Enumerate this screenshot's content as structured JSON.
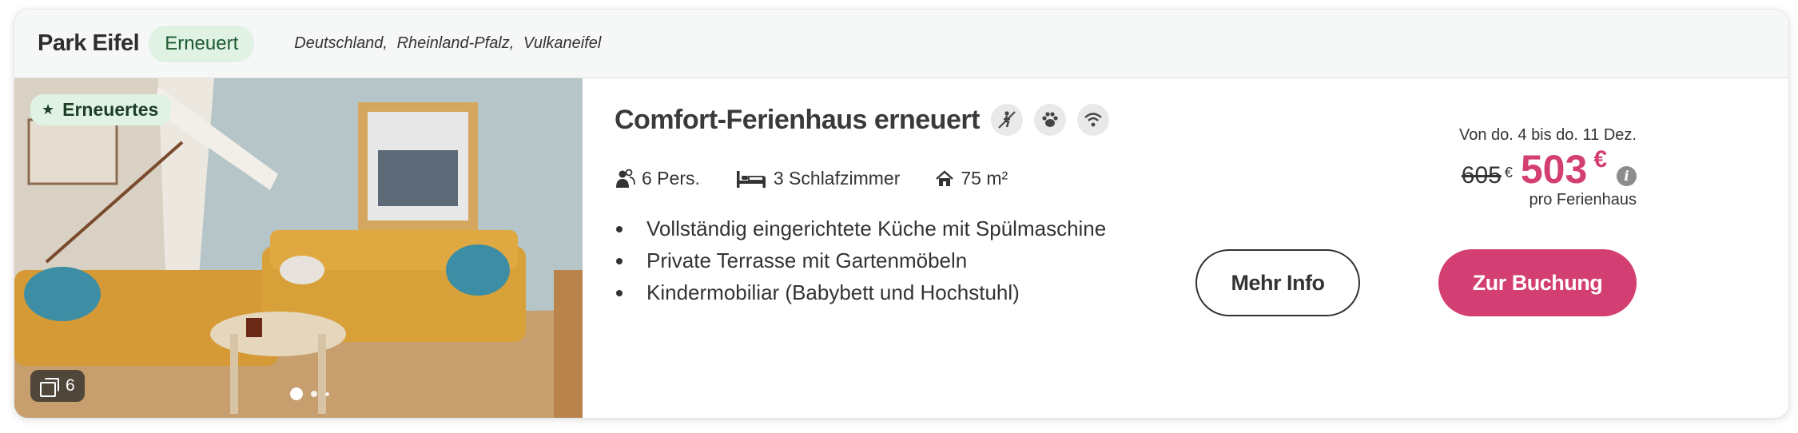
{
  "header": {
    "park_name": "Park Eifel",
    "badge": "Erneuert",
    "location": [
      "Deutschland,",
      "Rheinland-Pfalz,",
      "Vulkaneifel"
    ]
  },
  "photo": {
    "badge": "Erneuertes",
    "count": "6",
    "carousel_total_dots": 3,
    "carousel_active_index": 0
  },
  "accommodation": {
    "title": "Comfort-Ferienhaus erneuert",
    "amenities": [
      "no-smoking-icon",
      "pet-paw-icon",
      "wifi-icon"
    ],
    "specs": {
      "persons": "6 Pers.",
      "bedrooms": "3 Schlafzimmer",
      "area": "75 m²"
    },
    "features": [
      "Vollständig eingerichtete Küche mit Spülmaschine",
      "Private Terrasse mit Gartenmöbeln",
      "Kindermobiliar (Babybett und Hochstuhl)"
    ]
  },
  "pricing": {
    "date_range": "Von do. 4 bis do. 11 Dez.",
    "old_price": "605",
    "old_currency": "€",
    "new_price": "503",
    "new_currency": "€",
    "info_icon": "i",
    "per_unit": "pro Ferienhaus"
  },
  "actions": {
    "more_info": "Mehr Info",
    "book": "Zur Buchung"
  },
  "colors": {
    "accent": "#d33f72",
    "badge_bg": "#dff2e3",
    "badge_text": "#1e5a32",
    "header_bg": "#f6f8f7"
  }
}
